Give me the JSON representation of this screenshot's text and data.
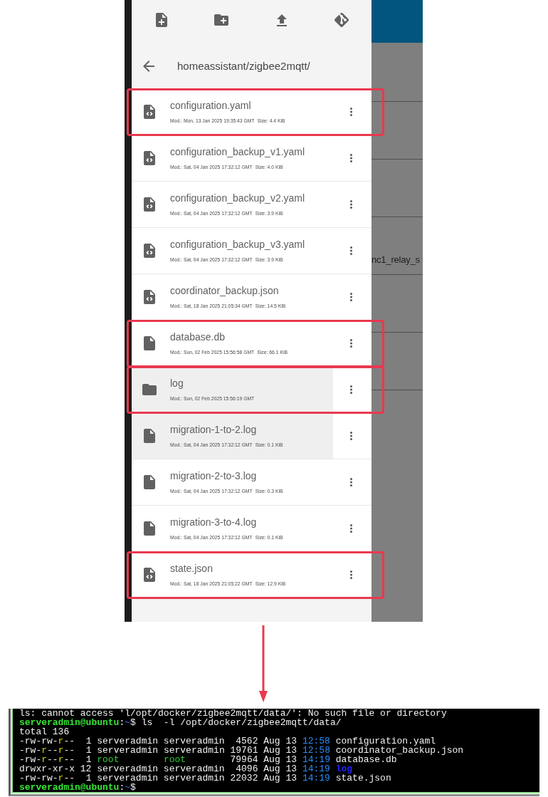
{
  "editor_panel": {
    "path": "homeassistant/zigbee2mqtt/",
    "files": [
      {
        "kind": "code",
        "name": "configuration.yaml",
        "modified": "Mod.: Mon, 13 Jan 2025 19:35:43 GMT",
        "size": "Size: 4.4 KiB",
        "highlighted": false,
        "annotated": true
      },
      {
        "kind": "code",
        "name": "configuration_backup_v1.yaml",
        "modified": "Mod.: Sat, 04 Jan 2025 17:32:12 GMT",
        "size": "Size: 4.0 KiB",
        "highlighted": false,
        "annotated": false
      },
      {
        "kind": "code",
        "name": "configuration_backup_v2.yaml",
        "modified": "Mod.: Sat, 04 Jan 2025 17:32:12 GMT",
        "size": "Size: 3.9 KiB",
        "highlighted": false,
        "annotated": false
      },
      {
        "kind": "code",
        "name": "configuration_backup_v3.yaml",
        "modified": "Mod.: Sat, 04 Jan 2025 17:32:12 GMT",
        "size": "Size: 3.9 KiB",
        "highlighted": false,
        "annotated": false
      },
      {
        "kind": "code",
        "name": "coordinator_backup.json",
        "modified": "Mod.: Sat, 18 Jan 2025 21:05:34 GMT",
        "size": "Size: 14.5 KiB",
        "highlighted": false,
        "annotated": false
      },
      {
        "kind": "file",
        "name": "database.db",
        "modified": "Mod.: Sun, 02 Feb 2025 15:56:58 GMT",
        "size": "Size: 66.1 KiB",
        "highlighted": false,
        "annotated": true
      },
      {
        "kind": "folder",
        "name": "log",
        "modified": "Mod.: Sun, 02 Feb 2025 15:56:19 GMT",
        "highlighted": true,
        "annotated": true
      },
      {
        "kind": "file",
        "name": "migration-1-to-2.log",
        "modified": "Mod.: Sat, 04 Jan 2025 17:32:12 GMT",
        "size": "Size: 0.1 KiB",
        "highlighted": true,
        "annotated": false
      },
      {
        "kind": "file",
        "name": "migration-2-to-3.log",
        "modified": "Mod.: Sat, 04 Jan 2025 17:32:12 GMT",
        "size": "Size: 0.3 KiB",
        "highlighted": false,
        "annotated": false
      },
      {
        "kind": "file",
        "name": "migration-3-to-4.log",
        "modified": "Mod.: Sat, 04 Jan 2025 17:32:12 GMT",
        "size": "Size: 0.1 KiB",
        "highlighted": false,
        "annotated": false
      },
      {
        "kind": "code",
        "name": "state.json",
        "modified": "Mod.: Sat, 18 Jan 2025 21:05:22 GMT",
        "size": "Size: 12.9 KiB",
        "highlighted": false,
        "annotated": true
      }
    ]
  },
  "background_list": {
    "row_text": "nc1_relay_s"
  },
  "terminal": {
    "lines": [
      [
        {
          "kind": "plain",
          "text": "ls: cannot access 'l/opt/docker/zigbee2mqtt/data/': No such file or directory"
        }
      ],
      [
        {
          "kind": "user",
          "text": "serveradmin@ubuntu"
        },
        {
          "kind": "plain",
          "text": ":"
        },
        {
          "kind": "home",
          "text": "~"
        },
        {
          "kind": "plain",
          "text": "$ ls  -l /opt/docker/zigbee2mqtt/data/"
        }
      ],
      [
        {
          "kind": "plain",
          "text": "total 136"
        }
      ],
      [
        {
          "kind": "plain",
          "text": "-rw-rw-"
        },
        {
          "kind": "perm",
          "text": "r"
        },
        {
          "kind": "plain",
          "text": "--  1 serveradmin serveradmin  4562 Aug 13 "
        },
        {
          "kind": "time",
          "text": "12:58"
        },
        {
          "kind": "plain",
          "text": " configuration.yaml"
        }
      ],
      [
        {
          "kind": "plain",
          "text": "-rw-"
        },
        {
          "kind": "perm",
          "text": "r"
        },
        {
          "kind": "plain",
          "text": "--"
        },
        {
          "kind": "perm",
          "text": "r"
        },
        {
          "kind": "plain",
          "text": "--  1 serveradmin serveradmin 19761 Aug 13 "
        },
        {
          "kind": "time",
          "text": "12:58"
        },
        {
          "kind": "plain",
          "text": " coordinator_backup.json"
        }
      ],
      [
        {
          "kind": "plain",
          "text": "-rw-"
        },
        {
          "kind": "perm",
          "text": "r"
        },
        {
          "kind": "plain",
          "text": "--"
        },
        {
          "kind": "perm",
          "text": "r"
        },
        {
          "kind": "plain",
          "text": "--  1 "
        },
        {
          "kind": "owner",
          "text": "root        root"
        },
        {
          "kind": "plain",
          "text": "        79964 Aug 13 "
        },
        {
          "kind": "time",
          "text": "14:19"
        },
        {
          "kind": "plain",
          "text": " database.db"
        }
      ],
      [
        {
          "kind": "plain",
          "text": "drwxr-xr-x 12 serveradmin serveradmin  4096 Aug 13 "
        },
        {
          "kind": "time",
          "text": "14:19 "
        },
        {
          "kind": "dir",
          "text": "log"
        }
      ],
      [
        {
          "kind": "plain",
          "text": "-rw-rw-"
        },
        {
          "kind": "perm",
          "text": "r"
        },
        {
          "kind": "plain",
          "text": "--  1 serveradmin serveradmin 22032 Aug 13 "
        },
        {
          "kind": "time",
          "text": "14:19"
        },
        {
          "kind": "plain",
          "text": " state.json"
        }
      ],
      [
        {
          "kind": "user",
          "text": "serveradmin@ubuntu"
        },
        {
          "kind": "plain",
          "text": ":"
        },
        {
          "kind": "home",
          "text": "~"
        },
        {
          "kind": "plain",
          "text": "$"
        }
      ]
    ]
  }
}
